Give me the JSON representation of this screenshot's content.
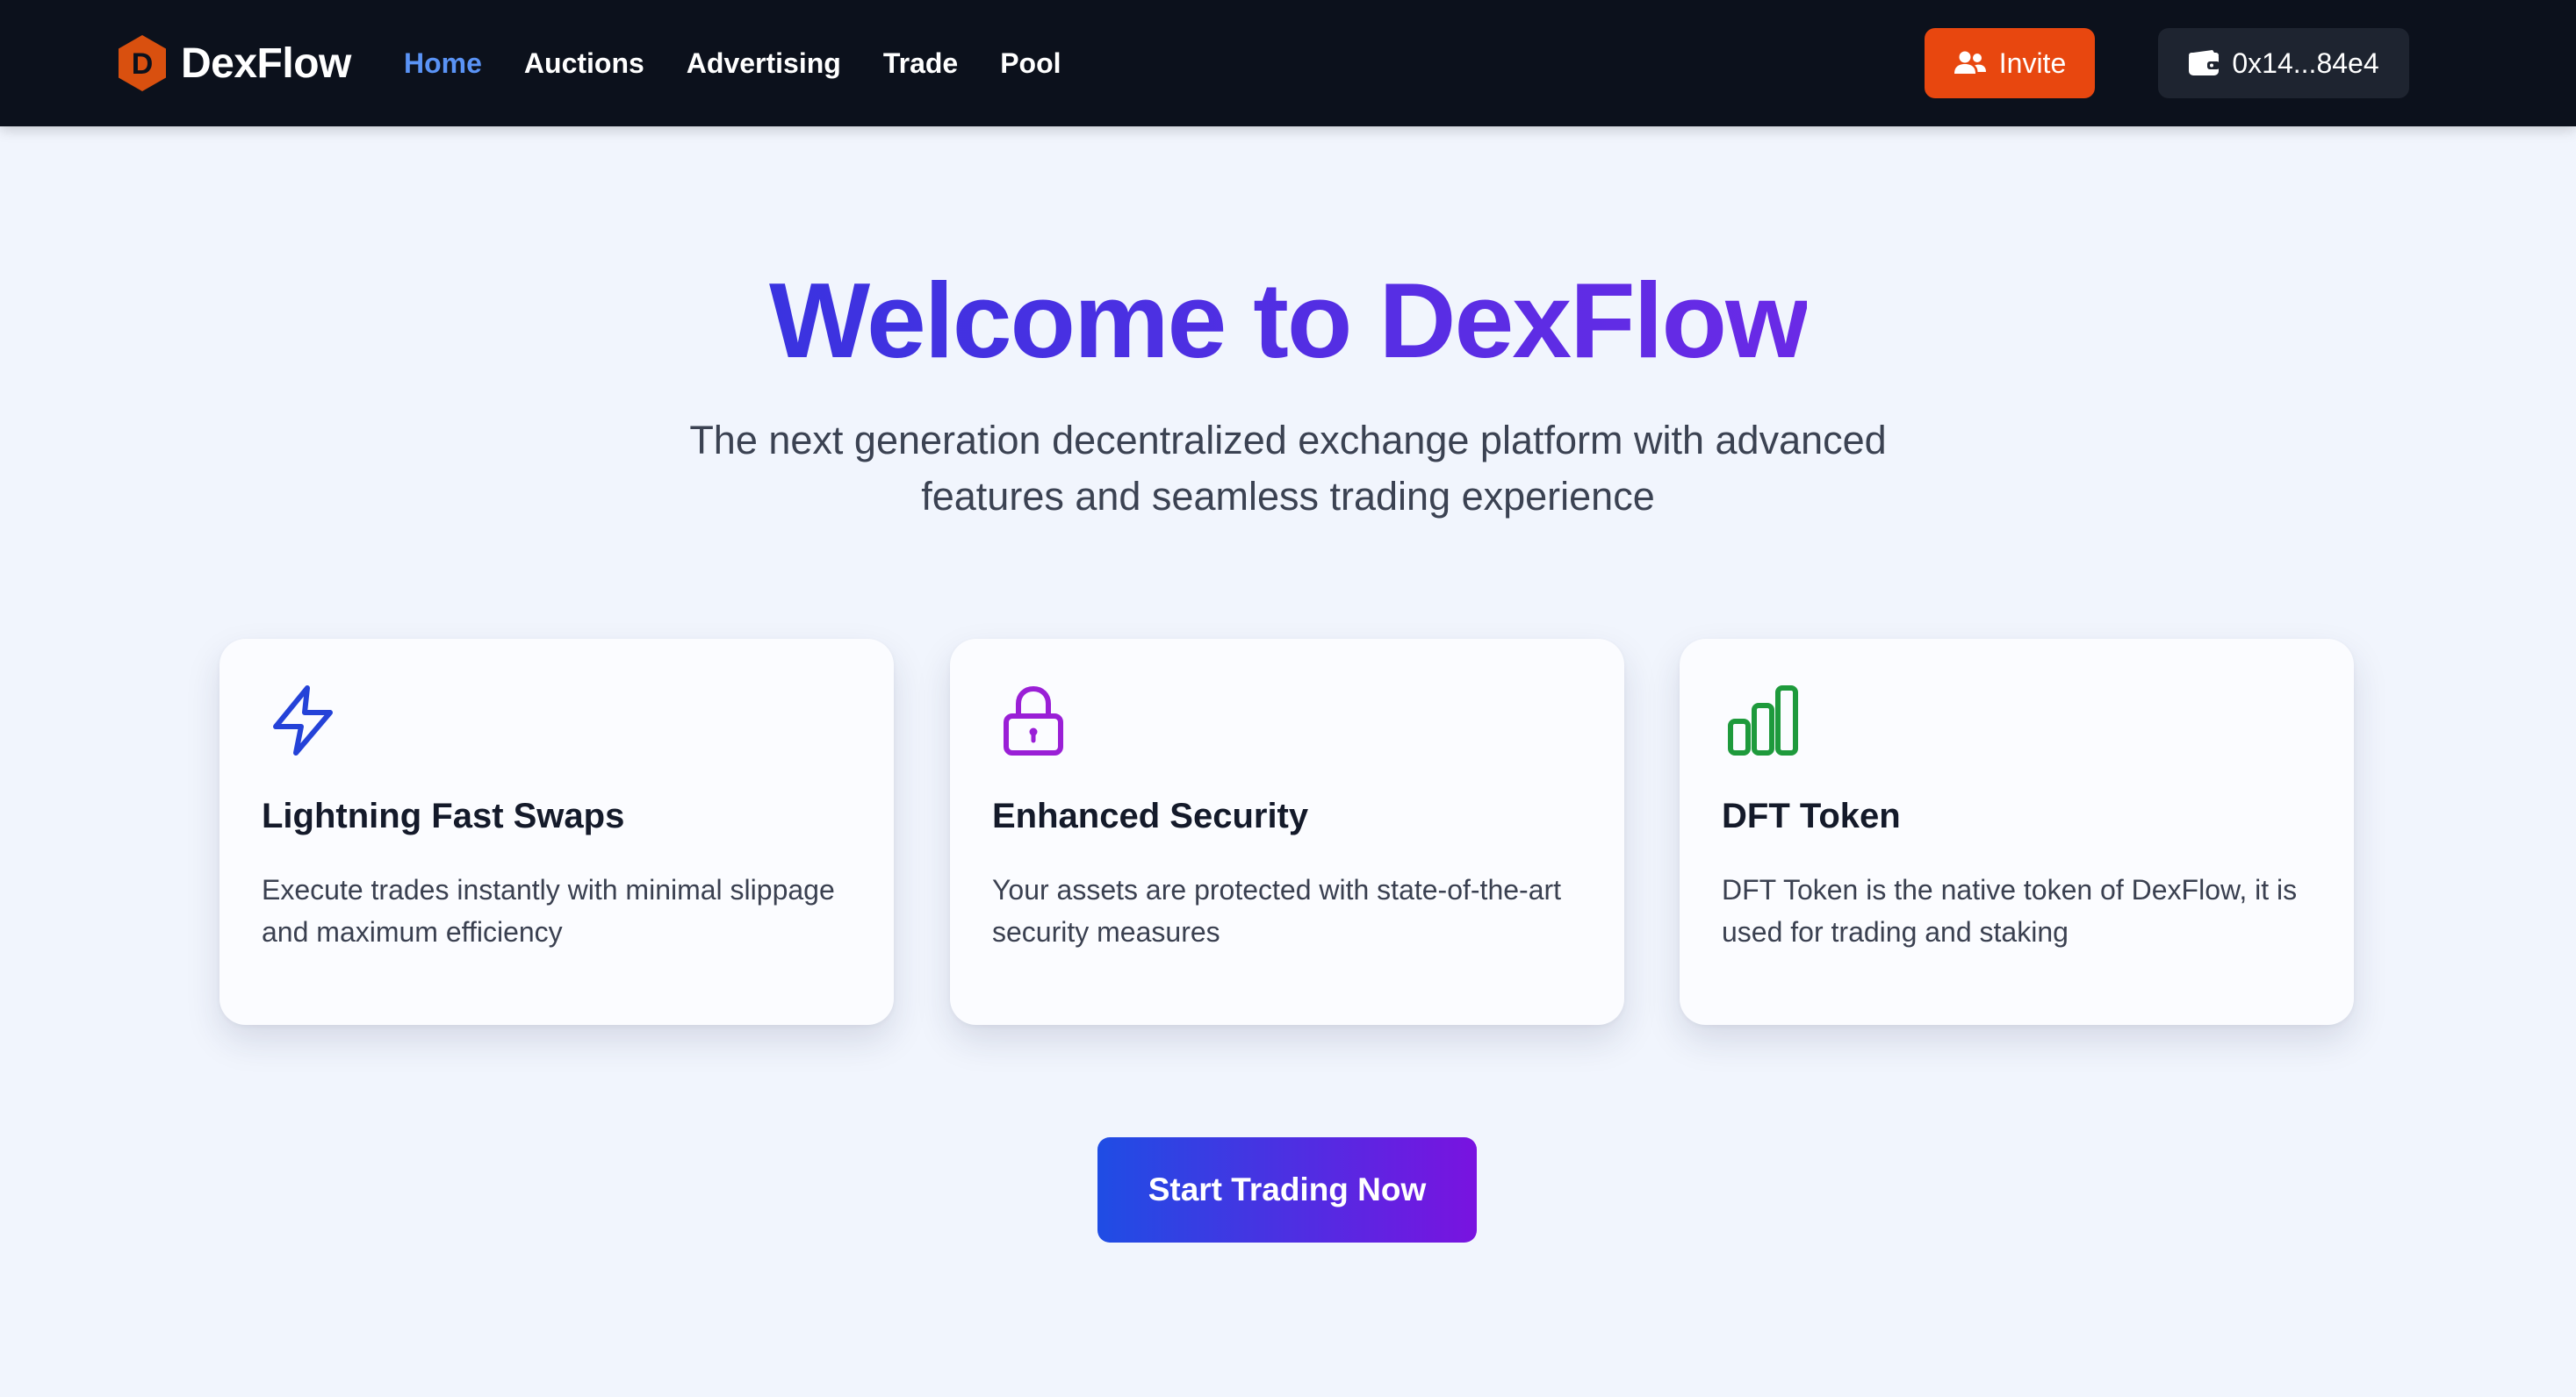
{
  "brand": {
    "name": "DexFlow",
    "logo_letter": "D",
    "logo_color": "#d9500f"
  },
  "nav": {
    "items": [
      {
        "label": "Home",
        "active": true
      },
      {
        "label": "Auctions",
        "active": false
      },
      {
        "label": "Advertising",
        "active": false
      },
      {
        "label": "Trade",
        "active": false
      },
      {
        "label": "Pool",
        "active": false
      }
    ]
  },
  "header": {
    "invite_label": "Invite",
    "invite_icon": "users-icon",
    "invite_color": "#e8470f",
    "wallet_address": "0x14...84e4",
    "wallet_icon": "wallet-icon"
  },
  "hero": {
    "title": "Welcome to DexFlow",
    "subtitle": "The next generation decentralized exchange platform with advanced features and seamless trading experience"
  },
  "features": [
    {
      "icon": "lightning-icon",
      "icon_color": "#2442d8",
      "title": "Lightning Fast Swaps",
      "description": "Execute trades instantly with minimal slippage and maximum efficiency"
    },
    {
      "icon": "lock-icon",
      "icon_color": "#9a1fd6",
      "title": "Enhanced Security",
      "description": "Your assets are protected with state-of-the-art security measures"
    },
    {
      "icon": "bar-chart-icon",
      "icon_color": "#1e9a3c",
      "title": "DFT Token",
      "description": "DFT Token is the native token of DexFlow, it is used for trading and staking"
    }
  ],
  "cta": {
    "label": "Start Trading Now"
  }
}
